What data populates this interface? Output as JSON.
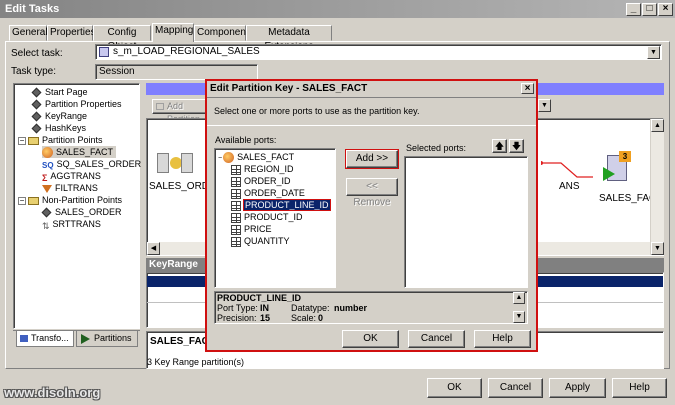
{
  "window": {
    "title": "Edit Tasks"
  },
  "tabs": [
    "General",
    "Properties",
    "Config Object",
    "Mapping",
    "Components",
    "Metadata Extensions"
  ],
  "select_task": {
    "label": "Select task:",
    "value": "s_m_LOAD_REGIONAL_SALES"
  },
  "task_type": {
    "label": "Task type:",
    "value": "Session"
  },
  "tree": {
    "items": [
      {
        "label": "Start Page",
        "icon": "diamond"
      },
      {
        "label": "Partition Properties",
        "icon": "diamond"
      },
      {
        "label": "KeyRange",
        "icon": "diamond"
      },
      {
        "label": "HashKeys",
        "icon": "diamond"
      },
      {
        "label": "Partition Points",
        "icon": "folder"
      },
      {
        "label": "SALES_FACT",
        "icon": "source"
      },
      {
        "label": "SQ_SALES_ORDER",
        "icon": "sq"
      },
      {
        "label": "AGGTRANS",
        "icon": "agg"
      },
      {
        "label": "FILTRANS",
        "icon": "filter"
      },
      {
        "label": "Non-Partition Points",
        "icon": "folder"
      },
      {
        "label": "SALES_ORDER",
        "icon": "source"
      },
      {
        "label": "SRTTRANS",
        "icon": "sort"
      }
    ]
  },
  "left_tabs": {
    "transformations": "Transfo...",
    "partitions": "Partitions"
  },
  "toolbar": {
    "add_partition": "Add Partition"
  },
  "canvas": {
    "left_label": "SALES_ORDER",
    "right_label": "SALES_FACT",
    "partial_label": "ANS",
    "badge": "3"
  },
  "keyrange": {
    "header": "KeyRange"
  },
  "bottom_status": {
    "name": "SALES_FACT",
    "info": "3 Key Range partition(s)"
  },
  "main_buttons": {
    "ok": "OK",
    "cancel": "Cancel",
    "apply": "Apply",
    "help": "Help"
  },
  "dialog": {
    "title": "Edit Partition Key - SALES_FACT",
    "instruction": "Select one or more ports to use as the partition key.",
    "available_label": "Available ports:",
    "root": "SALES_FACT",
    "ports": [
      "REGION_ID",
      "ORDER_ID",
      "ORDER_DATE",
      "PRODUCT_LINE_ID",
      "PRODUCT_ID",
      "PRICE",
      "QUANTITY"
    ],
    "selected_port": "PRODUCT_LINE_ID",
    "add_button": "Add >>",
    "remove_button": "<< Remove",
    "selected_label": "Selected ports:",
    "details": {
      "name": "PRODUCT_LINE_ID",
      "port_type_label": "Port Type:",
      "port_type": "IN",
      "datatype_label": "Datatype:",
      "datatype": "number",
      "precision_label": "Precision:",
      "precision": "15",
      "scale_label": "Scale:",
      "scale": "0"
    },
    "ok": "OK",
    "cancel": "Cancel",
    "help": "Help"
  },
  "watermark": "www.disoln.org"
}
